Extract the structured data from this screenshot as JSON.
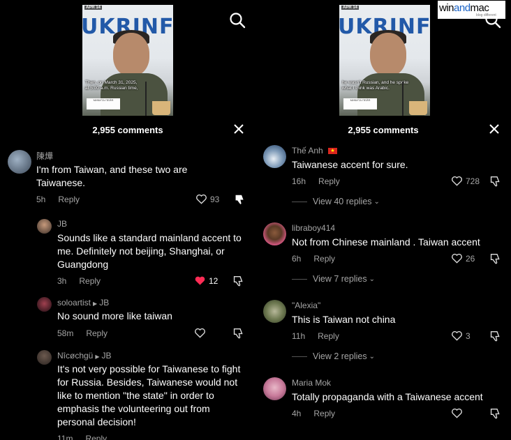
{
  "left": {
    "video": {
      "date": "APR 14",
      "brand": "UKRINFO",
      "subtitle": "Then, on March 31, 2025,\nat 5:00 a.m. Russian time,",
      "placard": "МИКИТА ПЕЙЯ"
    },
    "comment_count": "2,955 comments",
    "comments": [
      {
        "user": "陳燁",
        "text": "I'm from Taiwan, and these two are Taiwanese.",
        "time": "5h",
        "reply": "Reply",
        "likes": "93"
      },
      {
        "user": "JB",
        "text": "Sounds like a standard mainland accent to me. Definitely not beijing, Shanghai, or Guangdong",
        "time": "3h",
        "reply": "Reply",
        "likes": "12"
      },
      {
        "user": "soloartist",
        "reply_to": "JB",
        "text": "No sound more like taiwan",
        "time": "58m",
        "reply": "Reply",
        "likes": ""
      },
      {
        "user": "Nîcøchgü",
        "reply_to": "JB",
        "text": "It's not very possible for Taiwanese to fight for Russia. Besides, Taiwanese would not like to mention \"the state\" in order to emphasis the volunteering out from personal decision!",
        "time": "11m",
        "reply": "Reply",
        "likes": ""
      }
    ]
  },
  "right": {
    "video": {
      "date": "APR 14",
      "brand": "UKRINFO",
      "subtitle": "he wasn't Russian, and he spoke\nwhat I think was Arabic.",
      "placard": "МИКИТА ПЕЙЯ"
    },
    "comment_count": "2,955 comments",
    "comments": [
      {
        "user": "Thế Anh",
        "flag": "🇻🇳",
        "text": "Taiwanese accent for sure.",
        "time": "16h",
        "reply": "Reply",
        "likes": "728",
        "view_replies": "View 40 replies"
      },
      {
        "user": "libraboy414",
        "text": "Not from Chinese mainland . Taiwan accent",
        "time": "6h",
        "reply": "Reply",
        "likes": "26",
        "view_replies": "View 7 replies"
      },
      {
        "user": "\"Alexia\"",
        "text": "This is Taiwan not china",
        "time": "11h",
        "reply": "Reply",
        "likes": "3",
        "view_replies": "View 2 replies"
      },
      {
        "user": "Maria Mok",
        "text": "Totally propaganda with a Taiwanese accent",
        "time": "4h",
        "reply": "Reply",
        "likes": ""
      }
    ]
  },
  "watermark": {
    "brand_win": "win",
    "brand_and": "and",
    "brand_mac": "mac",
    "tagline": "blog different"
  },
  "colors": {
    "background": "#000000",
    "text": "#ffffff",
    "muted": "#a5a5a5",
    "liked": "#fe2c55"
  }
}
